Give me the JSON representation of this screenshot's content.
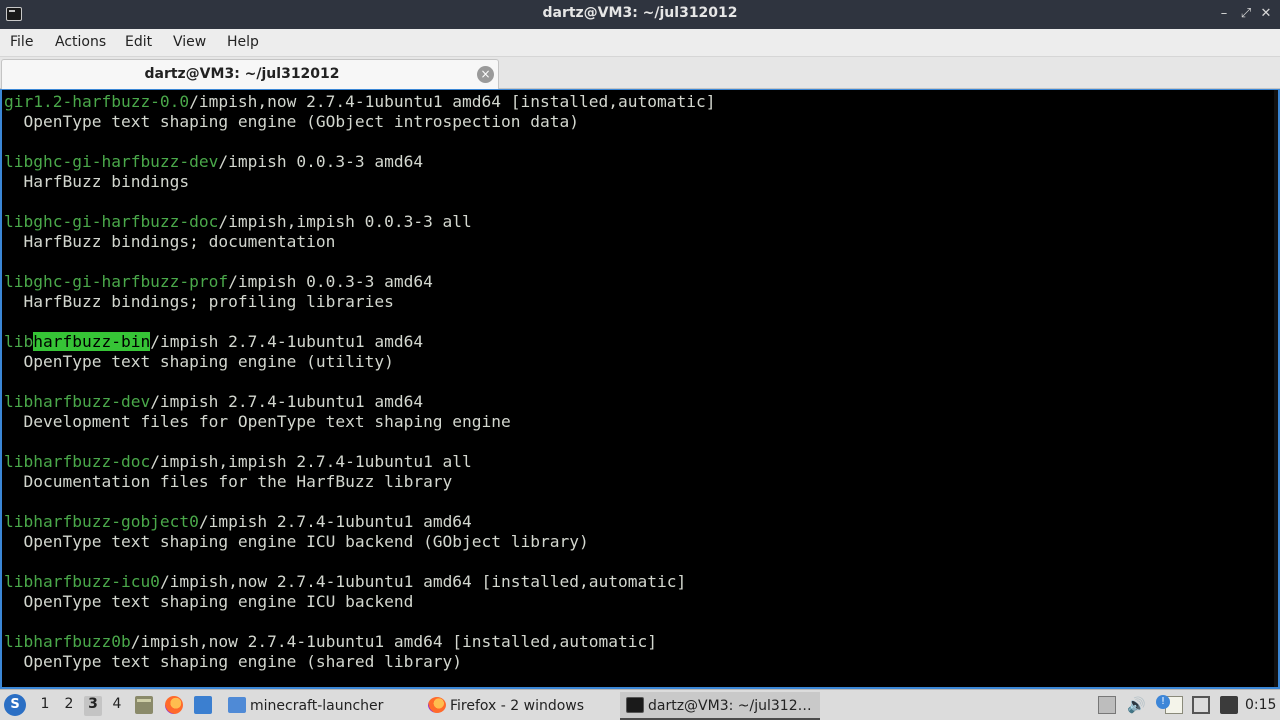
{
  "window": {
    "title": "dartz@VM3: ~/jul312012",
    "minimize_glyph": "–",
    "maximize_glyph": "⤢",
    "close_glyph": "✕"
  },
  "menu": {
    "file": "File",
    "actions": "Actions",
    "edit": "Edit",
    "view": "View",
    "help": "Help"
  },
  "tab": {
    "label": "dartz@VM3: ~/jul312012",
    "close_glyph": "×"
  },
  "terminal": {
    "colors": {
      "package": "#4aa84a",
      "highlight": "#36c436",
      "text": "#d3d7cf"
    },
    "lines": [
      {
        "pkg": "gir1.2-harfbuzz-0.0",
        "rest": "/impish,now 2.7.4-1ubuntu1 amd64 [installed,automatic]"
      },
      {
        "text": "  OpenType text shaping engine (GObject introspection data)"
      },
      {
        "text": ""
      },
      {
        "pkg": "libghc-gi-harfbuzz-dev",
        "rest": "/impish 0.0.3-3 amd64"
      },
      {
        "text": "  HarfBuzz bindings"
      },
      {
        "text": ""
      },
      {
        "pkg": "libghc-gi-harfbuzz-doc",
        "rest": "/impish,impish 0.0.3-3 all"
      },
      {
        "text": "  HarfBuzz bindings; documentation"
      },
      {
        "text": ""
      },
      {
        "pkg": "libghc-gi-harfbuzz-prof",
        "rest": "/impish 0.0.3-3 amd64"
      },
      {
        "text": "  HarfBuzz bindings; profiling libraries"
      },
      {
        "text": ""
      },
      {
        "pkg_pre": "lib",
        "pkg_hl": "harfbuzz-bin",
        "rest": "/impish 2.7.4-1ubuntu1 amd64"
      },
      {
        "text": "  OpenType text shaping engine (utility)"
      },
      {
        "text": ""
      },
      {
        "pkg": "libharfbuzz-dev",
        "rest": "/impish 2.7.4-1ubuntu1 amd64"
      },
      {
        "text": "  Development files for OpenType text shaping engine"
      },
      {
        "text": ""
      },
      {
        "pkg": "libharfbuzz-doc",
        "rest": "/impish,impish 2.7.4-1ubuntu1 all"
      },
      {
        "text": "  Documentation files for the HarfBuzz library"
      },
      {
        "text": ""
      },
      {
        "pkg": "libharfbuzz-gobject0",
        "rest": "/impish 2.7.4-1ubuntu1 amd64"
      },
      {
        "text": "  OpenType text shaping engine ICU backend (GObject library)"
      },
      {
        "text": ""
      },
      {
        "pkg": "libharfbuzz-icu0",
        "rest": "/impish,now 2.7.4-1ubuntu1 amd64 [installed,automatic]"
      },
      {
        "text": "  OpenType text shaping engine ICU backend"
      },
      {
        "text": ""
      },
      {
        "pkg": "libharfbuzz0b",
        "rest": "/impish,now 2.7.4-1ubuntu1 amd64 [installed,automatic]"
      },
      {
        "text": "  OpenType text shaping engine (shared library)"
      }
    ]
  },
  "taskbar": {
    "start_glyph": "S",
    "workspaces": [
      "1",
      "2",
      "3",
      "4"
    ],
    "active_workspace": "3",
    "tasks": {
      "minecraft": "minecraft-launcher",
      "firefox": "Firefox - 2 windows",
      "terminal": "dartz@VM3: ~/jul312…"
    },
    "volume_glyph": "🔊",
    "update_glyph": "!",
    "clock": "0:15"
  }
}
